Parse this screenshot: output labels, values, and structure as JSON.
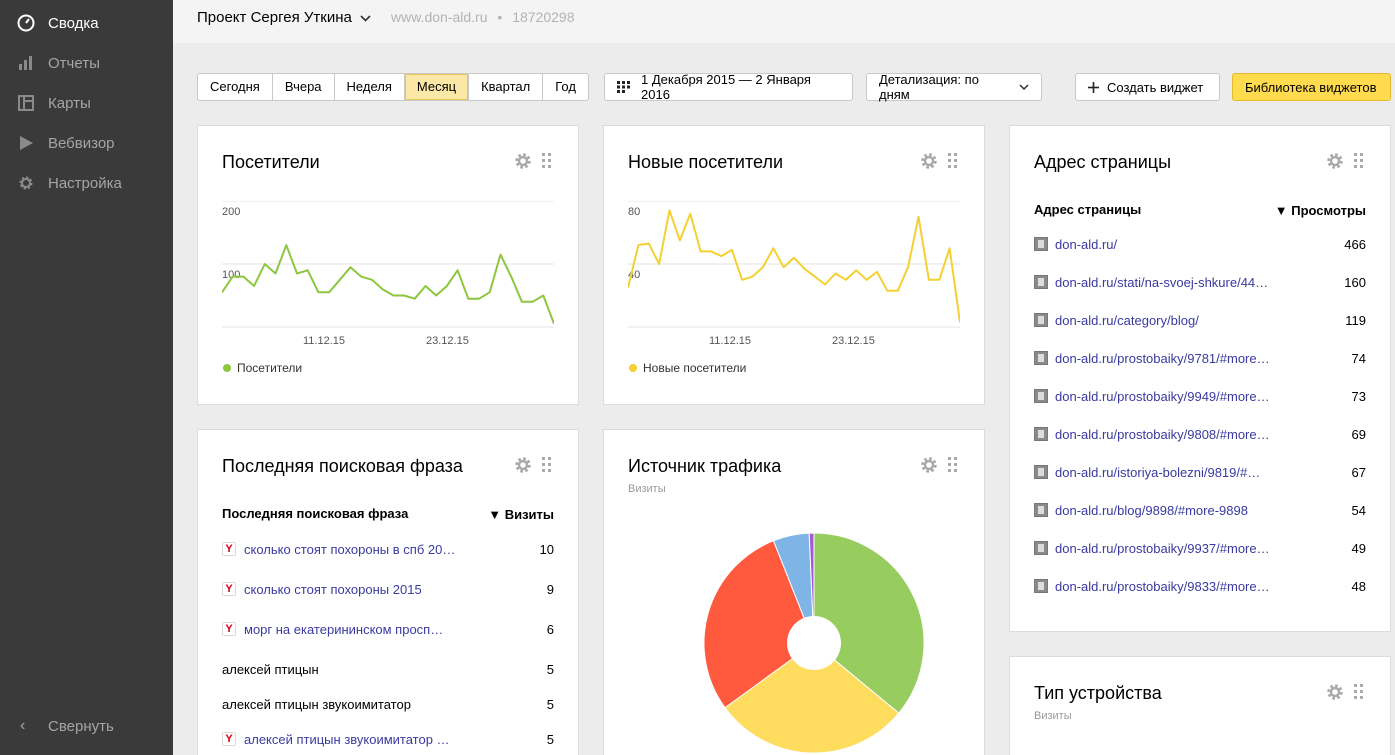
{
  "sidebar": {
    "items": [
      {
        "label": "Сводка",
        "icon": "dashboard-icon",
        "active": true
      },
      {
        "label": "Отчеты",
        "icon": "bar-chart-icon",
        "active": false
      },
      {
        "label": "Карты",
        "icon": "map-icon",
        "active": false
      },
      {
        "label": "Вебвизор",
        "icon": "play-icon",
        "active": false
      },
      {
        "label": "Настройка",
        "icon": "gear-icon",
        "active": false
      }
    ],
    "collapse_label": "Свернуть"
  },
  "header": {
    "project": "Проект Сергея Уткина",
    "site": "www.don-ald.ru",
    "counter_id": "18720298"
  },
  "toolbar": {
    "periods": [
      "Сегодня",
      "Вчера",
      "Неделя",
      "Месяц",
      "Квартал",
      "Год"
    ],
    "active_period": "Месяц",
    "date_range": "1 Декабря 2015 — 2 Января 2016",
    "detail": "Детализация: по дням",
    "create_widget": "Создать виджет",
    "library": "Библиотека виджетов"
  },
  "widgets": {
    "visitors": {
      "title": "Посетители",
      "legend": "Посетители",
      "color": "#8dc63f",
      "y_labels": [
        "200",
        "100"
      ],
      "x_labels": [
        "11.12.15",
        "23.12.15"
      ]
    },
    "new_visitors": {
      "title": "Новые посетители",
      "legend": "Новые посетители",
      "color": "#f5d033",
      "y_labels": [
        "80",
        "40"
      ],
      "x_labels": [
        "11.12.15",
        "23.12.15"
      ]
    },
    "search": {
      "title": "Последняя поисковая фраза",
      "col1": "Последняя поисковая фраза",
      "col2": "▼ Визиты",
      "rows": [
        {
          "text": "сколько стоят похороны в спб 20…",
          "value": "10",
          "icon": true
        },
        {
          "text": "сколько стоят похороны 2015",
          "value": "9",
          "icon": true
        },
        {
          "text": "морг на екатерининском просп…",
          "value": "6",
          "icon": true
        },
        {
          "text": "алексей птицын",
          "value": "5",
          "icon": false
        },
        {
          "text": "алексей птицын звукоимитатор",
          "value": "5",
          "icon": false
        },
        {
          "text": "алексей птицын звукоимитатор …",
          "value": "5",
          "icon": true
        }
      ]
    },
    "traffic": {
      "title": "Источник трафика",
      "subtitle": "Визиты",
      "slices": [
        {
          "value": 36,
          "color": "#97cc5f"
        },
        {
          "value": 29,
          "color": "#fedc5d"
        },
        {
          "value": 29,
          "color": "#ff5a3d"
        },
        {
          "value": 5.3,
          "color": "#7fb5e6"
        },
        {
          "value": 0.7,
          "color": "#a35bd6"
        }
      ]
    },
    "pages": {
      "title": "Адрес страницы",
      "col1": "Адрес страницы",
      "col2": "▼ Просмотры",
      "rows": [
        {
          "text": "don-ald.ru/",
          "value": "466"
        },
        {
          "text": "don-ald.ru/stati/na-svoej-shkure/44…",
          "value": "160"
        },
        {
          "text": "don-ald.ru/category/blog/",
          "value": "119"
        },
        {
          "text": "don-ald.ru/prostobaiky/9781/#more…",
          "value": "74"
        },
        {
          "text": "don-ald.ru/prostobaiky/9949/#more…",
          "value": "73"
        },
        {
          "text": "don-ald.ru/prostobaiky/9808/#more…",
          "value": "69"
        },
        {
          "text": "don-ald.ru/istoriya-bolezni/9819/#…",
          "value": "67"
        },
        {
          "text": "don-ald.ru/blog/9898/#more-9898",
          "value": "54"
        },
        {
          "text": "don-ald.ru/prostobaiky/9937/#more…",
          "value": "49"
        },
        {
          "text": "don-ald.ru/prostobaiky/9833/#more…",
          "value": "48"
        }
      ]
    },
    "device": {
      "title": "Тип устройства",
      "subtitle": "Визиты"
    }
  },
  "chart_data": [
    {
      "type": "line",
      "ylim": [
        0,
        200
      ],
      "series": [
        {
          "name": "Посетители",
          "values": [
            55,
            80,
            80,
            65,
            100,
            85,
            130,
            85,
            90,
            55,
            55,
            75,
            95,
            80,
            75,
            60,
            50,
            50,
            45,
            65,
            50,
            65,
            90,
            45,
            45,
            55,
            115,
            80,
            40,
            40,
            50,
            5
          ]
        }
      ]
    },
    {
      "type": "line",
      "ylim": [
        0,
        80
      ],
      "series": [
        {
          "name": "Новые посетители",
          "values": [
            25,
            52,
            53,
            40,
            74,
            55,
            72,
            48,
            48,
            45,
            49,
            30,
            32,
            38,
            50,
            38,
            44,
            37,
            32,
            27,
            34,
            30,
            36,
            30,
            35,
            23,
            23,
            38,
            70,
            30,
            30,
            50,
            3
          ]
        }
      ]
    }
  ]
}
